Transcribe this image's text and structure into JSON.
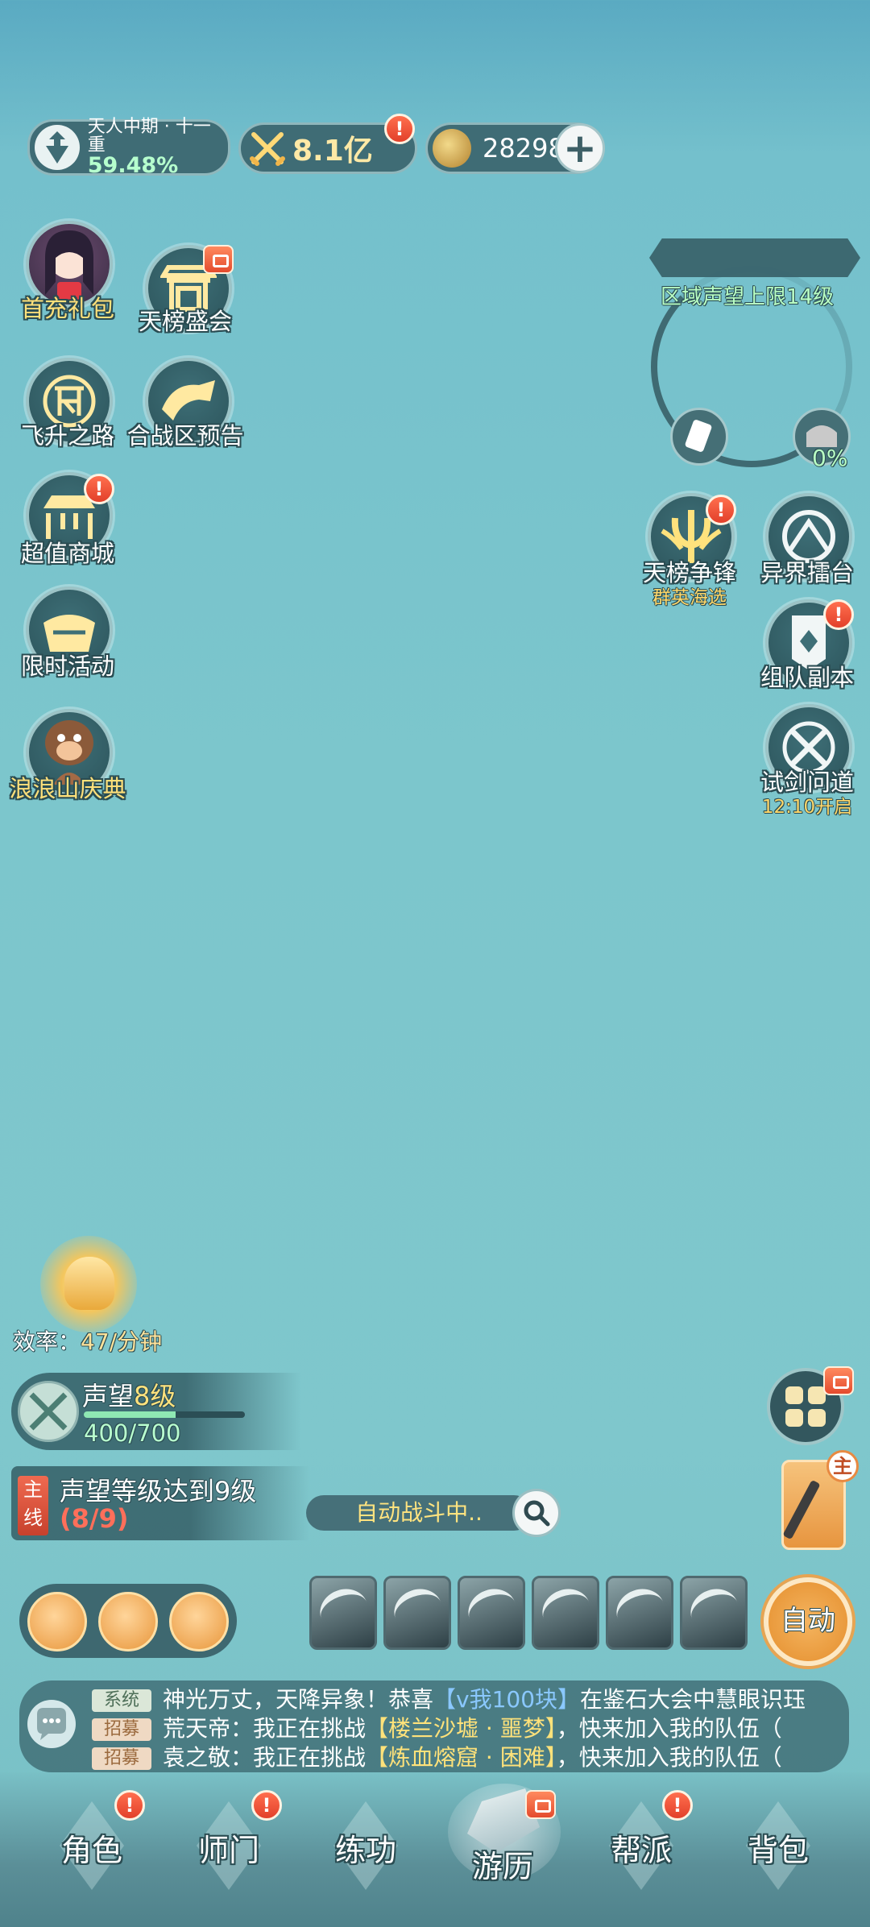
{
  "status": {
    "realm_name": "天人中期 · 十一重",
    "realm_progress": "59.48%",
    "combat_power": "8.1亿",
    "currency_amount": "28298"
  },
  "left_menu": [
    {
      "label": "首充礼包"
    },
    {
      "label": "天榜盛会"
    },
    {
      "label": "飞升之路"
    },
    {
      "label": "合战区预告"
    },
    {
      "label": "超值商城"
    },
    {
      "label": "限时活动"
    },
    {
      "label": "浪浪山庆典"
    }
  ],
  "region": {
    "title": "区域声望上限14级",
    "percent": "0%"
  },
  "right_menu": [
    {
      "label": "天榜争锋",
      "sub": "群英海选"
    },
    {
      "label": "异界擂台"
    },
    {
      "label": "组队副本"
    },
    {
      "label": "试剑问道",
      "sub": "12:10开启"
    }
  ],
  "efficiency": {
    "prefix": "效率：",
    "value": "47/分钟"
  },
  "prestige": {
    "title": "声望",
    "level": "8级",
    "progress_text": "400/700",
    "progress_fraction": 0.571
  },
  "quest": {
    "tag": "主线",
    "title": "声望等级达到9级",
    "progress": "(8/9)"
  },
  "battle": {
    "status": "自动战斗中..",
    "auto_label": "自动",
    "main_badge": "主"
  },
  "chat": [
    {
      "tag": "系统",
      "text_a": "神光万丈，天降异象！恭喜",
      "highlight": "【v我100块】",
      "text_b": "在鉴石大会中慧眼识珏"
    },
    {
      "tag": "招募",
      "text_a": "荒天帝：我正在挑战",
      "highlight": "【楼兰沙墟 · 噩梦】",
      "text_b": "，快来加入我的队伍（"
    },
    {
      "tag": "招募",
      "text_a": "袁之敬：我正在挑战",
      "highlight": "【炼血熔窟 · 困难】",
      "text_b": "，快来加入我的队伍（"
    }
  ],
  "nav": [
    {
      "label": "角色"
    },
    {
      "label": "师门"
    },
    {
      "label": "练功"
    },
    {
      "label": "游历"
    },
    {
      "label": "帮派"
    },
    {
      "label": "背包"
    }
  ],
  "alert_mark": "!"
}
